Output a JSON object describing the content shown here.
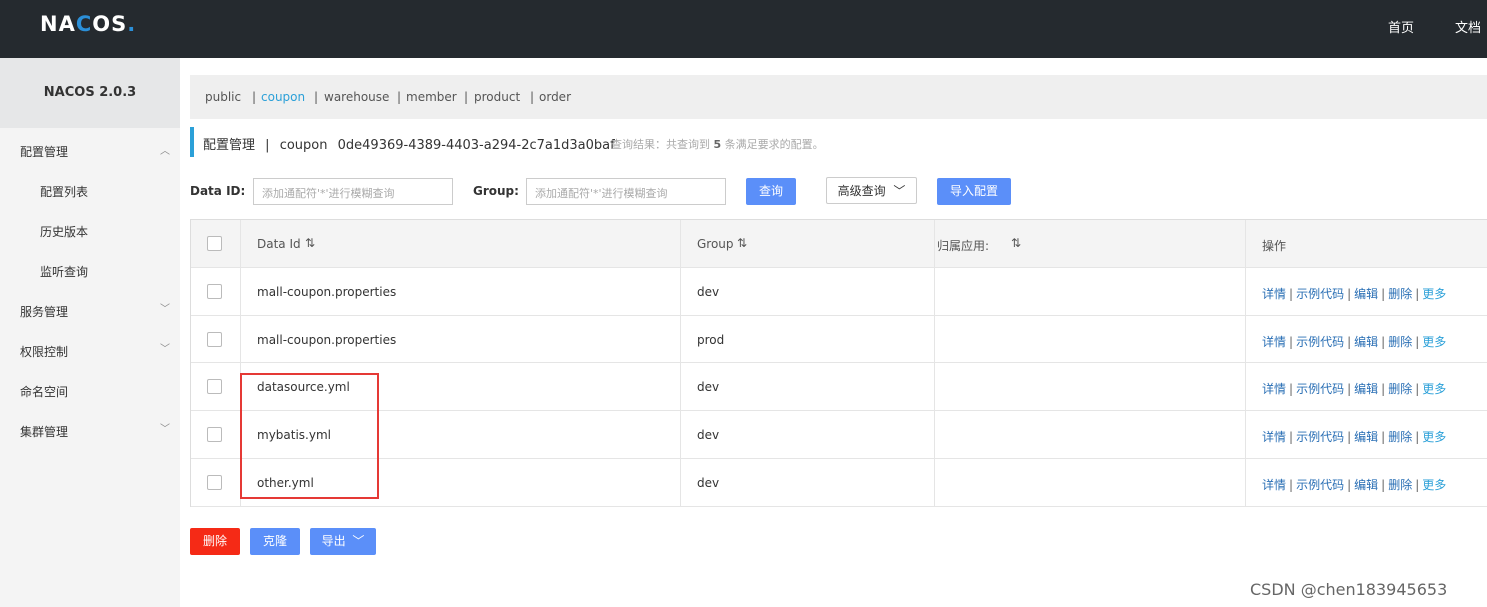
{
  "topbar": {
    "logo_pre": "NA",
    "logo_c": "C",
    "logo_post": "OS",
    "logo_dot": ".",
    "nav": [
      "首页",
      "文档"
    ]
  },
  "sidebar": {
    "version": "NACOS 2.0.3",
    "items": [
      {
        "label": "配置管理",
        "icon": "chevron-up-icon"
      },
      {
        "label": "配置列表"
      },
      {
        "label": "历史版本"
      },
      {
        "label": "监听查询"
      },
      {
        "label": "服务管理",
        "icon": "chevron-down-icon"
      },
      {
        "label": "权限控制",
        "icon": "chevron-down-icon"
      },
      {
        "label": "命名空间"
      },
      {
        "label": "集群管理",
        "icon": "chevron-down-icon"
      }
    ]
  },
  "namespaces": {
    "items": [
      "public",
      "coupon",
      "warehouse",
      "member",
      "product",
      "order"
    ],
    "active": "coupon",
    "separator": "|"
  },
  "title": {
    "section": "配置管理",
    "sep": "|",
    "namespace": "coupon",
    "namespace_id": "0de49369-4389-4403-a294-2c7a1d3a0baf"
  },
  "query_result": {
    "prefix": "查询结果：共查询到",
    "count": "5",
    "suffix": "条满足要求的配置。"
  },
  "search": {
    "data_id_label": "Data ID:",
    "data_id_placeholder": "添加通配符'*'进行模糊查询",
    "group_label": "Group:",
    "group_placeholder": "添加通配符'*'进行模糊查询",
    "query_button": "查询",
    "advanced_button": "高级查询",
    "import_button": "导入配置"
  },
  "table": {
    "headers": [
      "Data Id",
      "Group",
      "归属应用:",
      "操作"
    ],
    "sort_icon": "⇅",
    "rows": [
      {
        "data_id": "mall-coupon.properties",
        "group": "dev",
        "app": ""
      },
      {
        "data_id": "mall-coupon.properties",
        "group": "prod",
        "app": ""
      },
      {
        "data_id": "datasource.yml",
        "group": "dev",
        "app": ""
      },
      {
        "data_id": "mybatis.yml",
        "group": "dev",
        "app": ""
      },
      {
        "data_id": "other.yml",
        "group": "dev",
        "app": ""
      }
    ],
    "ops": [
      "详情",
      "示例代码",
      "编辑",
      "删除",
      "更多"
    ]
  },
  "bottom": {
    "delete_button": "删除",
    "clone_button": "克隆",
    "export_button": "导出"
  },
  "watermark": "CSDN @chen183945653",
  "colors": {
    "topbar": "#252a2f",
    "primary": "#5b8ff9",
    "danger": "#f52a16",
    "link": "#2a6fb5",
    "active_ns": "#2ba0d8",
    "highlight": "#e53935"
  }
}
